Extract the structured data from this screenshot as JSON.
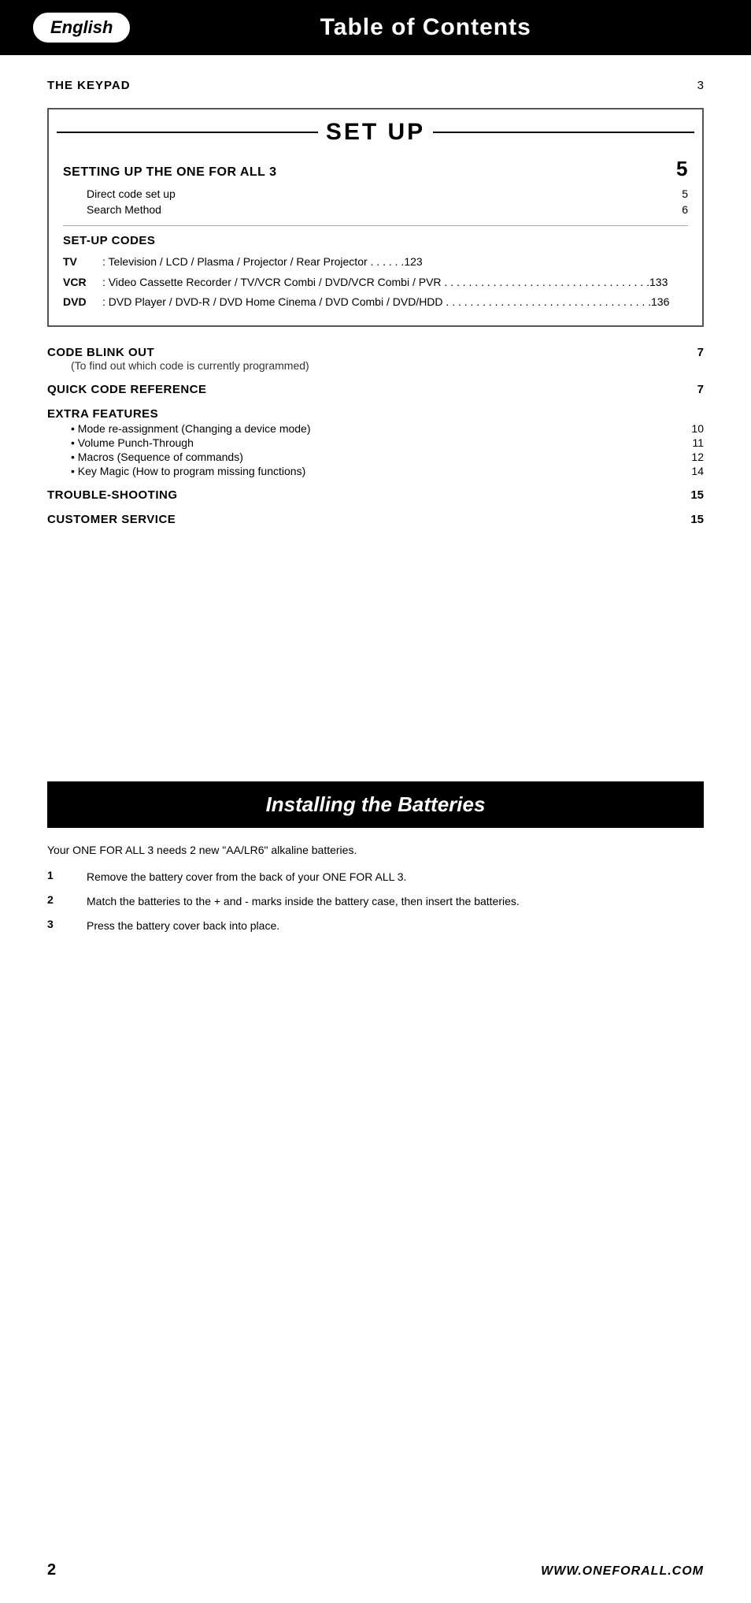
{
  "header": {
    "english_label": "English",
    "title": "Table of Contents"
  },
  "keypad": {
    "label": "THE KEYPAD",
    "page": "3"
  },
  "setup": {
    "title": "SET UP",
    "section_title": "SETTING UP THE ONE FOR ALL 3",
    "section_page": "5",
    "sub_items": [
      {
        "label": "Direct code set up",
        "page": "5"
      },
      {
        "label": "Search Method",
        "page": "6"
      }
    ],
    "codes_title": "SET-UP CODES",
    "codes": [
      {
        "type": "TV",
        "desc": ": Television / LCD / Plasma / Projector / Rear Projector  . . . . . .123"
      },
      {
        "type": "VCR",
        "desc": ": Video Cassette Recorder / TV/VCR Combi / DVD/VCR Combi / PVR . . . . . . . . . . . . . . . . . . . . . . . . . . . . . . . . . .133"
      },
      {
        "type": "DVD",
        "desc": ": DVD Player / DVD-R / DVD Home Cinema / DVD Combi / DVD/HDD . . . . . . . . . . . . . . . . . . . . . . . . . . . . . . . . . .136"
      }
    ]
  },
  "toc": {
    "code_blink_out": {
      "heading": "CODE BLINK OUT",
      "sub": "(To find out which code is currently programmed)",
      "page": "7"
    },
    "quick_code": {
      "heading": "QUICK CODE REFERENCE",
      "page": "7"
    },
    "extra_features": {
      "heading": "EXTRA FEATURES",
      "items": [
        {
          "label": "• Mode re-assignment (Changing a device mode)",
          "page": "10"
        },
        {
          "label": "• Volume Punch-Through",
          "page": "11"
        },
        {
          "label": "• Macros (Sequence of commands)",
          "page": "12"
        },
        {
          "label": "• Key Magic (How to program missing functions)",
          "page": "14"
        }
      ]
    },
    "trouble": {
      "heading": "TROUBLE-SHOOTING",
      "page": "15"
    },
    "customer": {
      "heading": "CUSTOMER SERVICE",
      "page": "15"
    }
  },
  "batteries": {
    "title": "Installing the Batteries",
    "intro": "Your ONE FOR ALL 3 needs 2 new \"AA/LR6\" alkaline batteries.",
    "steps": [
      {
        "num": "1",
        "text": "Remove the battery cover from the back of your ONE FOR ALL 3."
      },
      {
        "num": "2",
        "text": "Match the batteries to the + and - marks inside the battery case, then insert the batteries."
      },
      {
        "num": "3",
        "text": "Press the battery cover back into place."
      }
    ]
  },
  "footer": {
    "page": "2",
    "url": "WWW.ONEFORALL.COM"
  }
}
